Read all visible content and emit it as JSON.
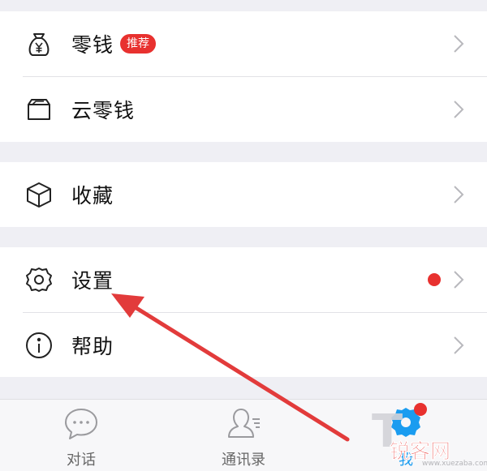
{
  "menu": {
    "wallet": {
      "label": "零钱",
      "badge": "推荐"
    },
    "cloud_wallet": {
      "label": "云零钱"
    },
    "favorites": {
      "label": "收藏"
    },
    "settings": {
      "label": "设置"
    },
    "help": {
      "label": "帮助"
    }
  },
  "tabbar": {
    "tabs": [
      {
        "label": "对话",
        "icon": "chat-bubble-icon"
      },
      {
        "label": "通讯录",
        "icon": "contacts-icon"
      },
      {
        "label": "我",
        "icon": "gear-icon",
        "active": true
      }
    ]
  },
  "watermark": {
    "logo": "锐客网",
    "url": "www.xuezaba.com"
  },
  "colors": {
    "accent_red": "#e8312f",
    "active_tab_blue": "#1a9cf0",
    "annotation_arrow": "#e23b3b"
  }
}
